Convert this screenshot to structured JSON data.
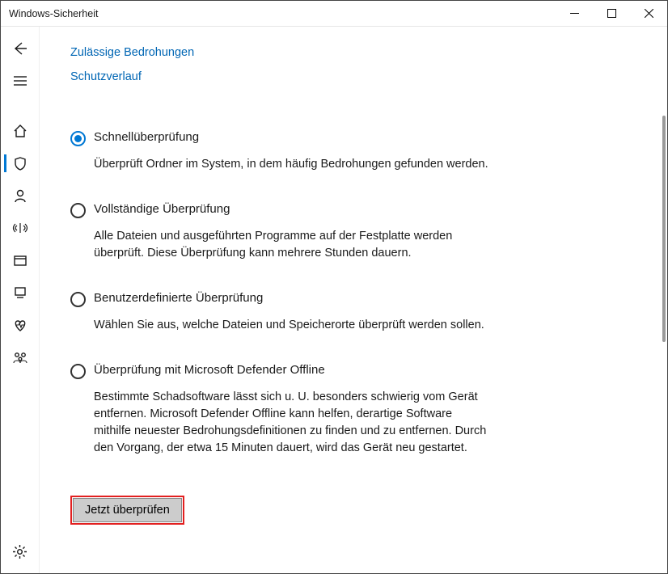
{
  "window": {
    "title": "Windows-Sicherheit"
  },
  "links": {
    "allowed": "Zulässige Bedrohungen",
    "history": "Schutzverlauf"
  },
  "options": [
    {
      "title": "Schnellüberprüfung",
      "desc": "Überprüft Ordner im System, in dem häufig Bedrohungen gefunden werden.",
      "selected": true
    },
    {
      "title": "Vollständige Überprüfung",
      "desc": "Alle Dateien und ausgeführten Programme auf der Festplatte werden überprüft. Diese Überprüfung kann mehrere Stunden dauern.",
      "selected": false
    },
    {
      "title": "Benutzerdefinierte Überprüfung",
      "desc": "Wählen Sie aus, welche Dateien und Speicherorte überprüft werden sollen.",
      "selected": false
    },
    {
      "title": "Überprüfung mit Microsoft Defender Offline",
      "desc": "Bestimmte Schadsoftware lässt sich u. U. besonders schwierig vom Gerät entfernen. Microsoft Defender Offline kann helfen, derartige Software mithilfe neuester Bedrohungsdefinitionen zu finden und zu entfernen. Durch den Vorgang, der etwa 15 Minuten dauert, wird das Gerät neu gestartet.",
      "selected": false
    }
  ],
  "scan_button": "Jetzt überprüfen"
}
